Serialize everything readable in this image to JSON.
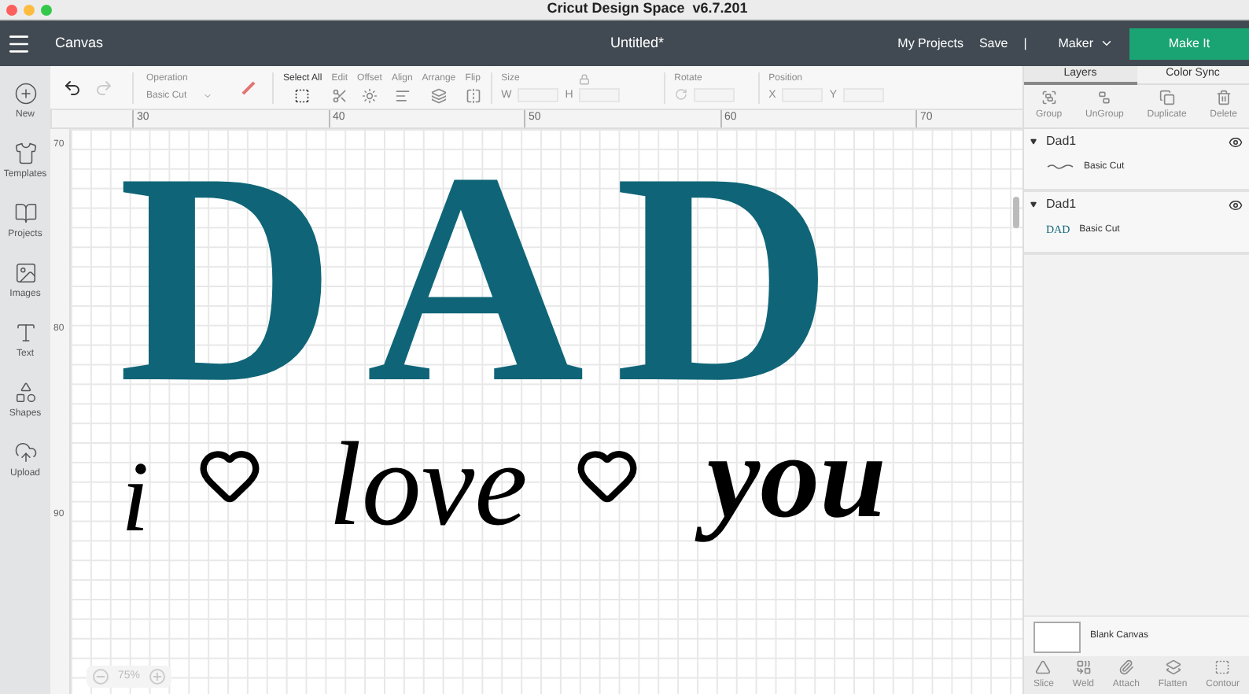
{
  "window": {
    "title": "Cricut Design Space  v6.7.201"
  },
  "header": {
    "section": "Canvas",
    "document_title": "Untitled*",
    "links": [
      "My Projects",
      "Save"
    ],
    "separator": "|",
    "machine": "Maker",
    "primary_button": "Make It"
  },
  "sidebar": {
    "items": [
      {
        "kind": "new",
        "label": "New"
      },
      {
        "kind": "templates",
        "label": "Templates"
      },
      {
        "kind": "projects",
        "label": "Projects"
      },
      {
        "kind": "images",
        "label": "Images"
      },
      {
        "kind": "text",
        "label": "Text"
      },
      {
        "kind": "shapes",
        "label": "Shapes"
      },
      {
        "kind": "upload",
        "label": "Upload"
      }
    ]
  },
  "toolbar": {
    "undo_disabled": false,
    "redo_disabled": true,
    "operation": {
      "label": "Operation",
      "value": "Basic Cut",
      "disabled": true
    },
    "tools": [
      {
        "kind": "select",
        "label": "Select All",
        "disabled": false
      },
      {
        "kind": "edit",
        "label": "Edit",
        "disabled": true
      },
      {
        "kind": "offset",
        "label": "Offset",
        "disabled": true
      },
      {
        "kind": "align",
        "label": "Align",
        "disabled": true
      },
      {
        "kind": "arrange",
        "label": "Arrange",
        "disabled": true
      },
      {
        "kind": "flip",
        "label": "Flip",
        "disabled": true
      }
    ],
    "size": {
      "label": "Size",
      "fields": [
        "W",
        "H"
      ]
    },
    "rotate": {
      "label": "Rotate"
    },
    "position": {
      "label": "Position",
      "fields": [
        "X",
        "Y"
      ]
    }
  },
  "rulers": {
    "horizontal": [
      "30",
      "40",
      "50",
      "60",
      "70"
    ],
    "vertical": [
      "70",
      "80",
      "90"
    ]
  },
  "canvas": {
    "title_art": "DAD",
    "script_words": [
      "i",
      "love",
      "you"
    ],
    "zoom": "75%"
  },
  "panel": {
    "tabs": [
      {
        "label": "Layers",
        "selected": true
      },
      {
        "label": "Color Sync",
        "selected": false
      }
    ],
    "actions": [
      {
        "kind": "group",
        "label": "Group",
        "disabled": true
      },
      {
        "kind": "ungroup",
        "label": "UnGroup",
        "disabled": true
      },
      {
        "kind": "duplicate",
        "label": "Duplicate",
        "disabled": true
      },
      {
        "kind": "delete",
        "label": "Delete",
        "disabled": true
      }
    ],
    "layers": [
      {
        "name": "Dad1",
        "expanded": true,
        "visible": true,
        "children": [
          {
            "kind": "script",
            "label": "Basic Cut"
          }
        ]
      },
      {
        "name": "Dad1",
        "expanded": true,
        "visible": true,
        "children": [
          {
            "kind": "text",
            "thumb_text": "DAD",
            "label": "Basic Cut"
          }
        ]
      }
    ],
    "blank_canvas": "Blank Canvas",
    "bottom_actions": [
      {
        "kind": "slice",
        "label": "Slice",
        "disabled": true
      },
      {
        "kind": "weld",
        "label": "Weld",
        "disabled": true
      },
      {
        "kind": "attach",
        "label": "Attach",
        "disabled": true
      },
      {
        "kind": "flatten",
        "label": "Flatten",
        "disabled": true
      },
      {
        "kind": "contour",
        "label": "Contour",
        "disabled": true
      }
    ]
  }
}
